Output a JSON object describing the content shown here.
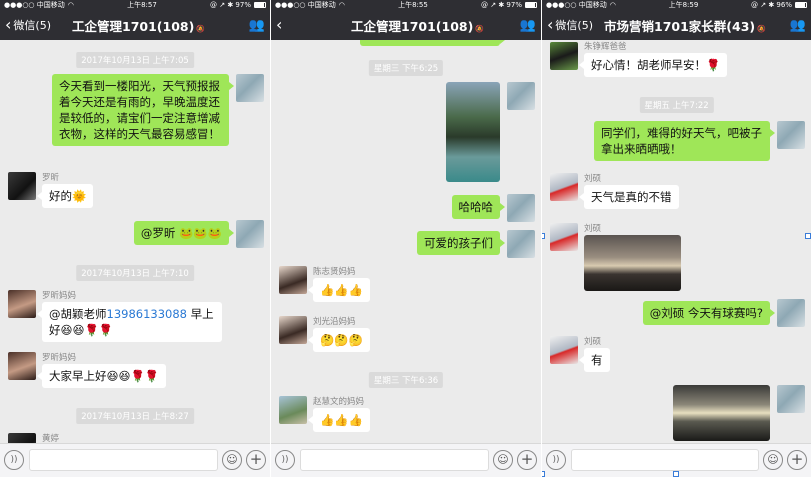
{
  "screens": [
    {
      "status": {
        "carrier": "●●●○○ 中国移动",
        "wifi": "◠",
        "time": "上午8:57",
        "right": "@ ↗ ✱ 97%"
      },
      "nav": {
        "back": "微信(5)",
        "title": "工企管理1701(108)",
        "mute": "🔕",
        "person_icon": "group-icon"
      },
      "times": [
        "2017年10月13日 上午7:05",
        "2017年10月13日 上午7:10",
        "2017年10月13日 上午8:27"
      ],
      "messages": {
        "m1": "今天看到一楼阳光，天气预报报着今天还是有雨的，早晚温度还是较低的，请宝们一定注意增减衣物，这样的天气最容易感冒！",
        "n2": "罗昕",
        "m2": "好的🌞",
        "m3": "@罗昕 🐸🐸🐸",
        "n4": "罗昕妈妈",
        "m4a": "@胡颖老师",
        "m4b": "13986133088",
        "m4c": " 早上好😆😆🌹🌹",
        "n5": "罗昕妈妈",
        "m5": "大家早上好😆😆🌹🌹",
        "n6": "黄婷"
      }
    },
    {
      "status": {
        "carrier": "●●●○○ 中国移动",
        "wifi": "◠",
        "time": "上午8:55",
        "right": "@ ↗ ✱ 97%"
      },
      "nav": {
        "back": "",
        "title": "工企管理1701(108)",
        "mute": "🔕",
        "person_icon": "group-icon"
      },
      "times": [
        "星期三 下午6:25",
        "星期三 下午6:36"
      ],
      "messages": {
        "m2": "哈哈哈",
        "m3": "可爱的孩子们",
        "n4": "陈志贤妈妈",
        "m4": "👍👍👍",
        "n5": "刘光沿妈妈",
        "m5": "🤔🤔🤔",
        "n6": "赵慧文的妈妈",
        "m6": "👍👍👍"
      }
    },
    {
      "status": {
        "carrier": "●●●○○ 中国移动",
        "wifi": "◠",
        "time": "上午8:59",
        "right": "@ ↗ ✱ 96%"
      },
      "nav": {
        "back": "微信(5)",
        "title": "市场营销1701家长群(43)",
        "mute": "🔕",
        "person_icon": "group-icon"
      },
      "times": [
        "星期五 上午7:22"
      ],
      "messages": {
        "n1": "朱铮辉爸爸",
        "m1": "好心情！胡老师早安！🌹",
        "m2": "同学们，难得的好天气，吧被子拿出来晒晒哦！",
        "n3": "刘硕",
        "m3": "天气是真的不错",
        "n4": "刘硕",
        "m5": "@刘硕 今天有球赛吗?",
        "n6": "刘硕",
        "m6": "有"
      }
    }
  ],
  "inputbar": {
    "voice_icon": "voice-icon",
    "emoji_icon": "emoji-icon",
    "plus_icon": "plus-icon"
  }
}
